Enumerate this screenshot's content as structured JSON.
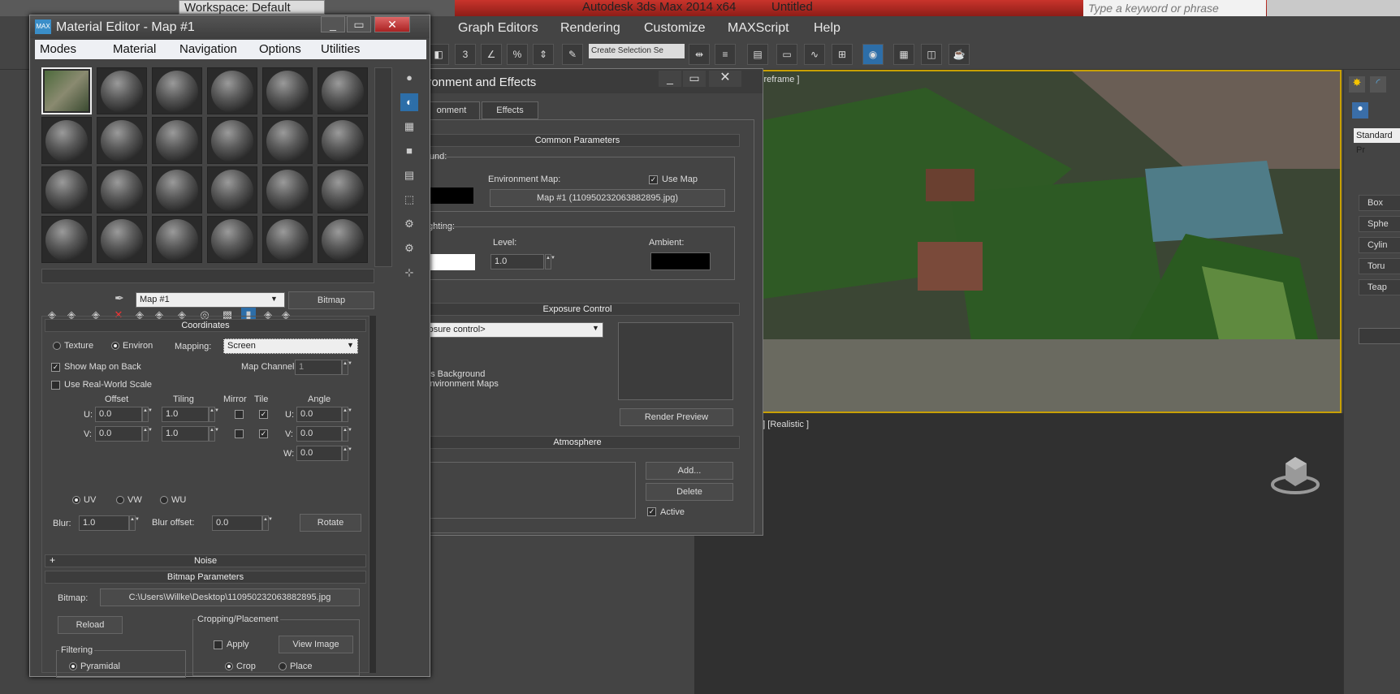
{
  "app": {
    "title": "Autodesk 3ds Max  2014 x64",
    "file": "Untitled",
    "workspace": "Workspace: Default",
    "search_placeholder": "Type a keyword or phrase"
  },
  "main_menu": [
    "Graph Editors",
    "Rendering",
    "Customize",
    "MAXScript",
    "Help"
  ],
  "toolbar": {
    "selection_set_placeholder": "Create Selection Se"
  },
  "viewports": {
    "top_label": "ireframe ]",
    "bottom_label": "e ] [Realistic ]"
  },
  "command_panel": {
    "dropdown": "Standard Pr",
    "buttons": [
      "Box",
      "Sphe",
      "Cylin",
      "Toru",
      "Teap"
    ]
  },
  "environment": {
    "title": "ironment and Effects",
    "tabs": [
      "onment",
      "Effects"
    ],
    "common": {
      "header": "Common Parameters",
      "background_label": "ground:",
      "color_label": "r:",
      "env_map_label": "Environment Map:",
      "use_map_label": "Use Map",
      "map_button": "Map #1 (110950232063882895.jpg)",
      "lighting_label": "l Lighting:",
      "level_label": "Level:",
      "level_value": "1.0",
      "ambient_label": "Ambient:"
    },
    "exposure": {
      "header": "Exposure Control",
      "dropdown": "xposure control>",
      "active_label": "ive",
      "process_bg": "cess Background",
      "env_maps": "d Environment Maps",
      "render_preview": "Render Preview"
    },
    "atmosphere": {
      "header": "Atmosphere",
      "effects_label": "s:",
      "add": "Add...",
      "delete": "Delete",
      "active": "Active"
    }
  },
  "material_editor": {
    "title": "Material Editor - Map #1",
    "menu": [
      "Modes",
      "Material",
      "Navigation",
      "Options",
      "Utilities"
    ],
    "map_name": "Map #1",
    "type_button": "Bitmap",
    "coordinates": {
      "header": "Coordinates",
      "texture": "Texture",
      "environ": "Environ",
      "mapping_label": "Mapping:",
      "mapping_value": "Screen",
      "show_map_on_back": "Show Map on Back",
      "map_channel_label": "Map Channel:",
      "map_channel_value": "1",
      "use_real_world": "Use Real-World Scale",
      "col_offset": "Offset",
      "col_tiling": "Tiling",
      "col_mirror": "Mirror",
      "col_tile": "Tile",
      "col_angle": "Angle",
      "u_label": "U:",
      "v_label": "V:",
      "w_label": "W:",
      "u_offset": "0.0",
      "v_offset": "0.0",
      "u_tiling": "1.0",
      "v_tiling": "1.0",
      "u_angle": "0.0",
      "v_angle": "0.0",
      "w_angle": "0.0",
      "uv": "UV",
      "vw": "VW",
      "wu": "WU",
      "blur_label": "Blur:",
      "blur_value": "1.0",
      "blur_offset_label": "Blur offset:",
      "blur_offset_value": "0.0",
      "rotate": "Rotate"
    },
    "noise_header": "Noise",
    "bitmap_params": {
      "header": "Bitmap Parameters",
      "bitmap_label": "Bitmap:",
      "bitmap_path": "C:\\Users\\Willke\\Desktop\\110950232063882895.jpg",
      "reload": "Reload",
      "cropping": "Cropping/Placement",
      "apply": "Apply",
      "view_image": "View Image",
      "crop": "Crop",
      "place": "Place",
      "filtering": "Filtering",
      "pyramidal": "Pyramidal"
    }
  },
  "colors": {
    "viewport_border": "#c8a000",
    "accent": "#3a8ec8",
    "close": "#c0392b"
  }
}
